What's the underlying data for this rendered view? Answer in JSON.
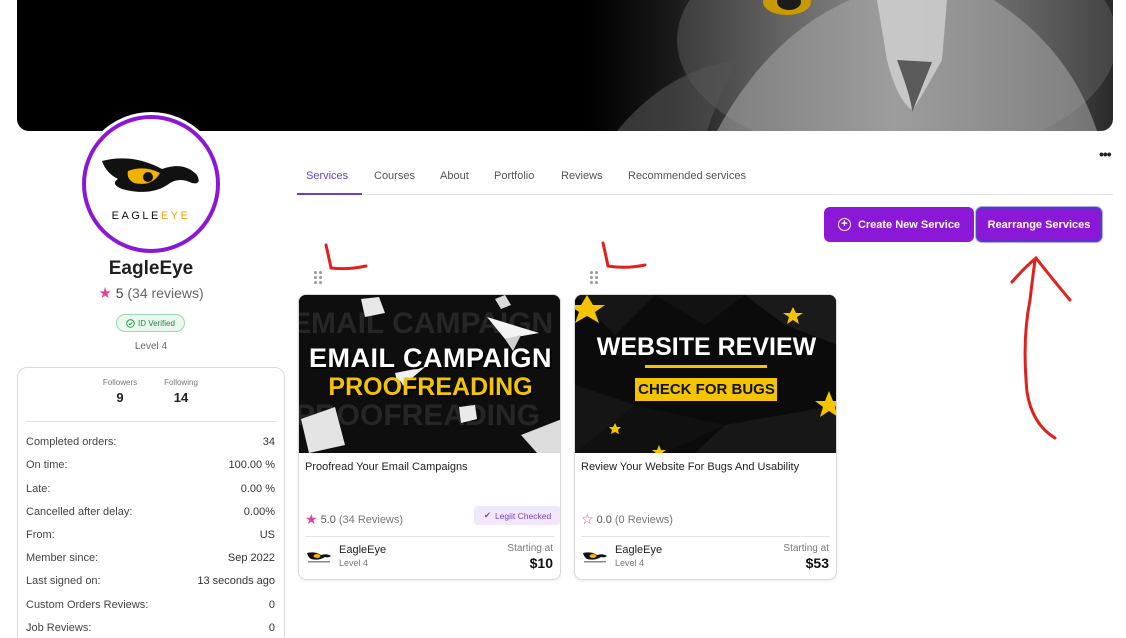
{
  "profile": {
    "logo_text": "EAGLEEYE",
    "name": "EagleEye",
    "rating_value": "5",
    "rating_count": "(34 reviews)",
    "verified_label": "ID Verified",
    "level": "Level 4"
  },
  "stats": {
    "followers_label": "Followers",
    "followers_value": "9",
    "following_label": "Following",
    "following_value": "14",
    "rows": [
      {
        "label": "Completed orders:",
        "value": "34"
      },
      {
        "label": "On time:",
        "value": "100.00 %"
      },
      {
        "label": "Late:",
        "value": "0.00 %"
      },
      {
        "label": "Cancelled after delay:",
        "value": "0.00%"
      },
      {
        "label": "From:",
        "value": "US"
      },
      {
        "label": "Member since:",
        "value": "Sep 2022"
      },
      {
        "label": "Last signed on:",
        "value": "13 seconds ago"
      },
      {
        "label": "Custom Orders Reviews:",
        "value": "0"
      },
      {
        "label": "Job Reviews:",
        "value": "0"
      }
    ]
  },
  "tabs": [
    "Services",
    "Courses",
    "About",
    "Portfolio",
    "Reviews",
    "Recommended services"
  ],
  "active_tab": "Services",
  "more_label": "•••",
  "buttons": {
    "create": "Create New Service",
    "rearrange": "Rearrange Services"
  },
  "cards": [
    {
      "thumb_line1": "EMAIL CAMPAIGN",
      "thumb_line2": "PROOFREADING",
      "title": "Proofread Your Email Campaigns",
      "rating": "5.0",
      "reviews": "(34 Reviews)",
      "badge": "Legiit Checked",
      "seller": "EagleEye",
      "seller_level": "Level 4",
      "starting_label": "Starting at",
      "price": "$10"
    },
    {
      "thumb_line1": "WEBSITE REVIEW",
      "thumb_line2": "CHECK FOR BUGS",
      "title": "Review Your Website For Bugs And Usability",
      "rating": "0.0",
      "reviews": "(0 Reviews)",
      "seller": "EagleEye",
      "seller_level": "Level 4",
      "starting_label": "Starting at",
      "price": "$53"
    }
  ],
  "colors": {
    "brand": "#8a18d6",
    "accent": "#6c3fc5",
    "star": "#e8409a",
    "annotation": "#e0201c"
  },
  "icons": [
    "eagle-logo-icon",
    "star-icon",
    "check-circle-icon",
    "plus-circle-icon",
    "drag-handle-icon",
    "checkmark-icon"
  ]
}
